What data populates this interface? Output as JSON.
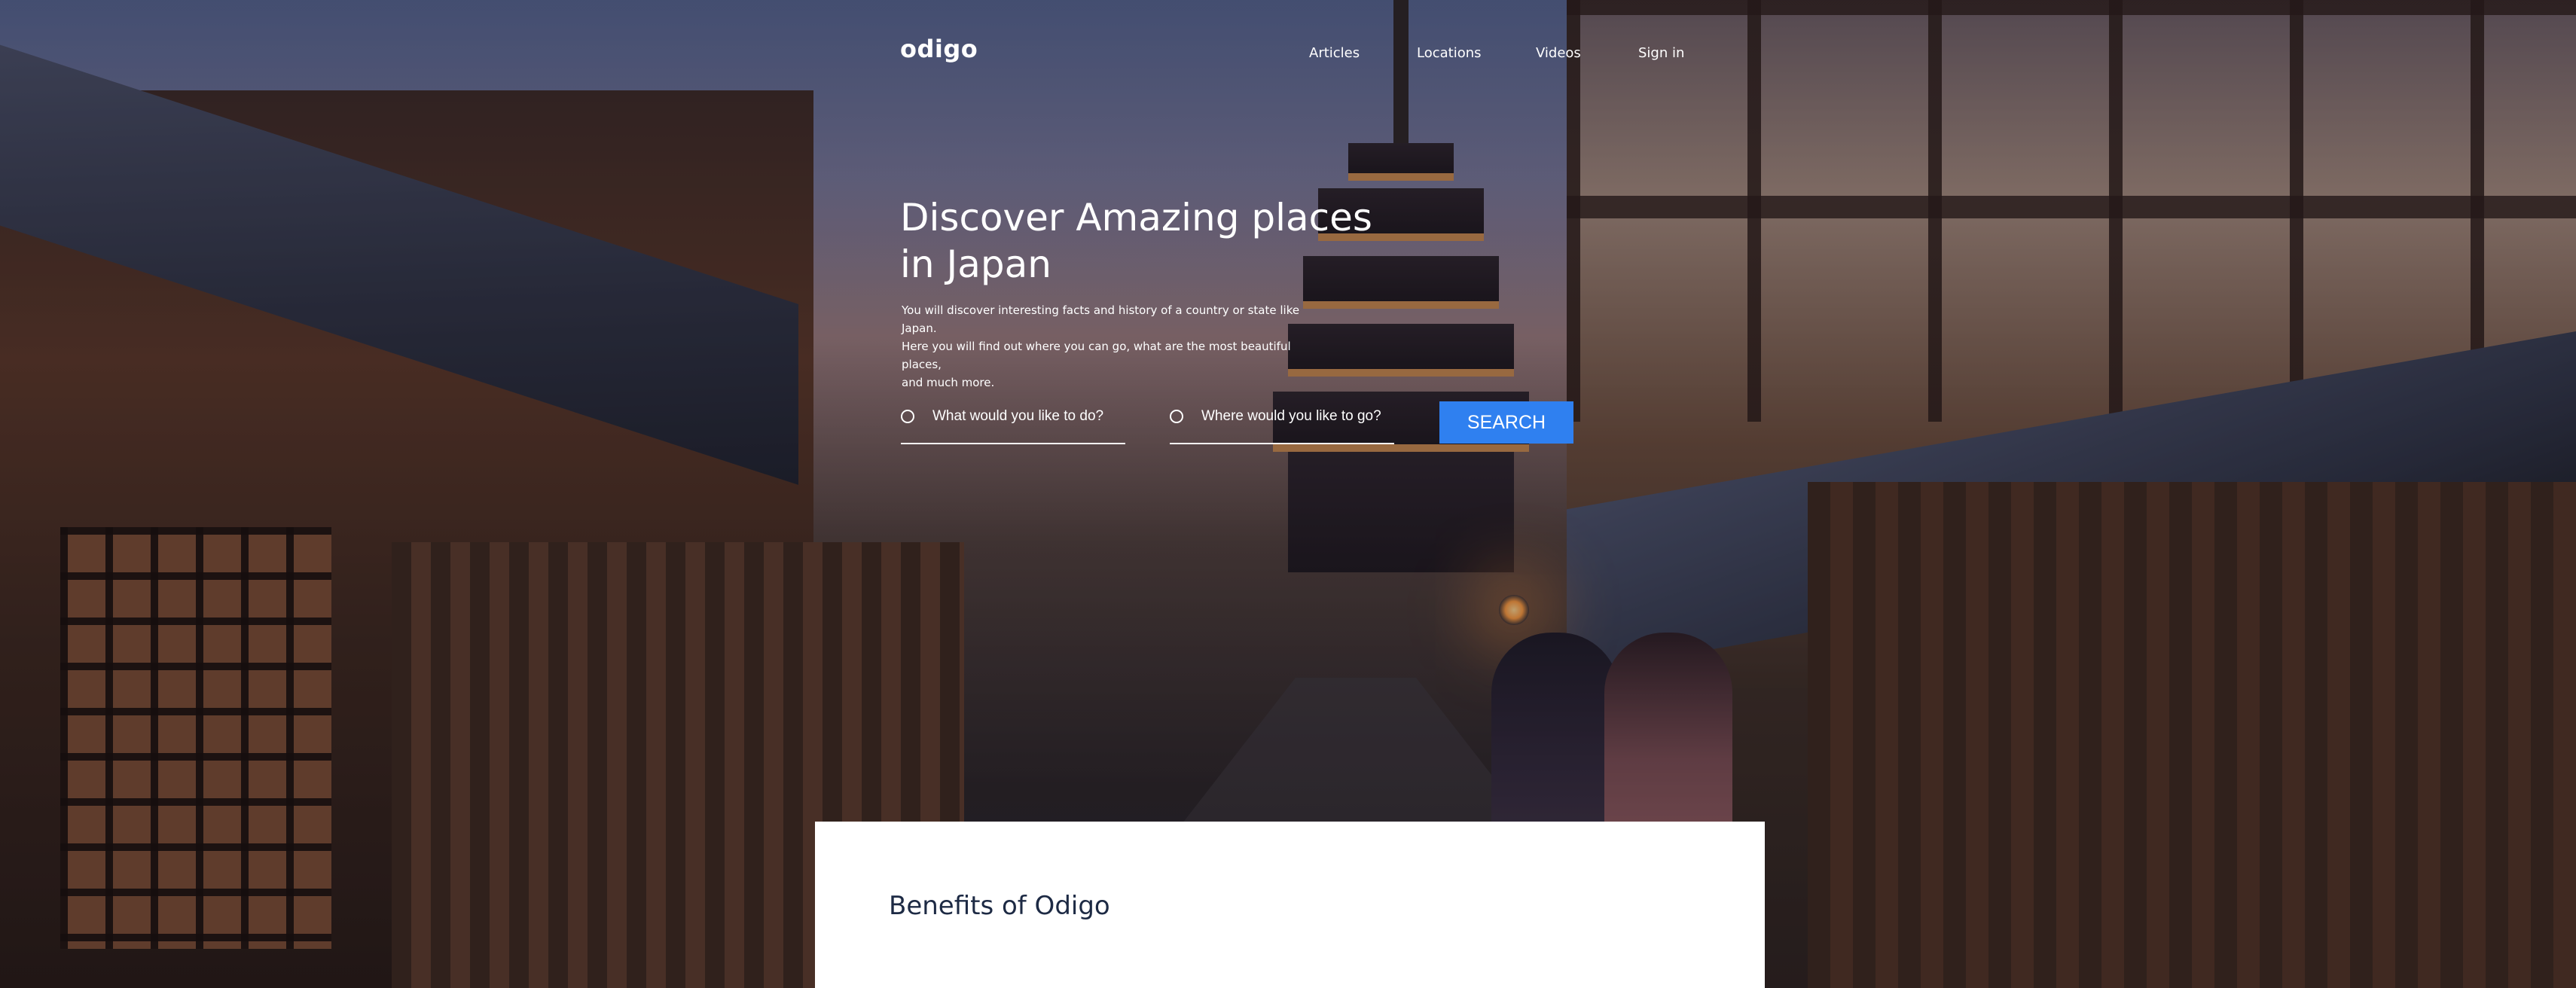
{
  "header": {
    "logo": "odigo",
    "nav": [
      {
        "label": "Articles"
      },
      {
        "label": "Locations"
      },
      {
        "label": "Videos"
      },
      {
        "label": "Sign in"
      }
    ]
  },
  "hero": {
    "title": "Discover Amazing places in Japan",
    "description_lines": [
      "You will discover interesting facts and history of a country or state like Japan.",
      "Here you will find out where you can go, what are the most beautiful places,",
      "and much more."
    ],
    "search": {
      "what_placeholder": "What would you like to do?",
      "where_placeholder": "Where would you like to go?",
      "button_label": "SEARCH"
    }
  },
  "benefits": {
    "title": "Benefits of Odigo"
  },
  "colors": {
    "accent": "#2f80f0",
    "heading_dark": "#1d2a44"
  }
}
